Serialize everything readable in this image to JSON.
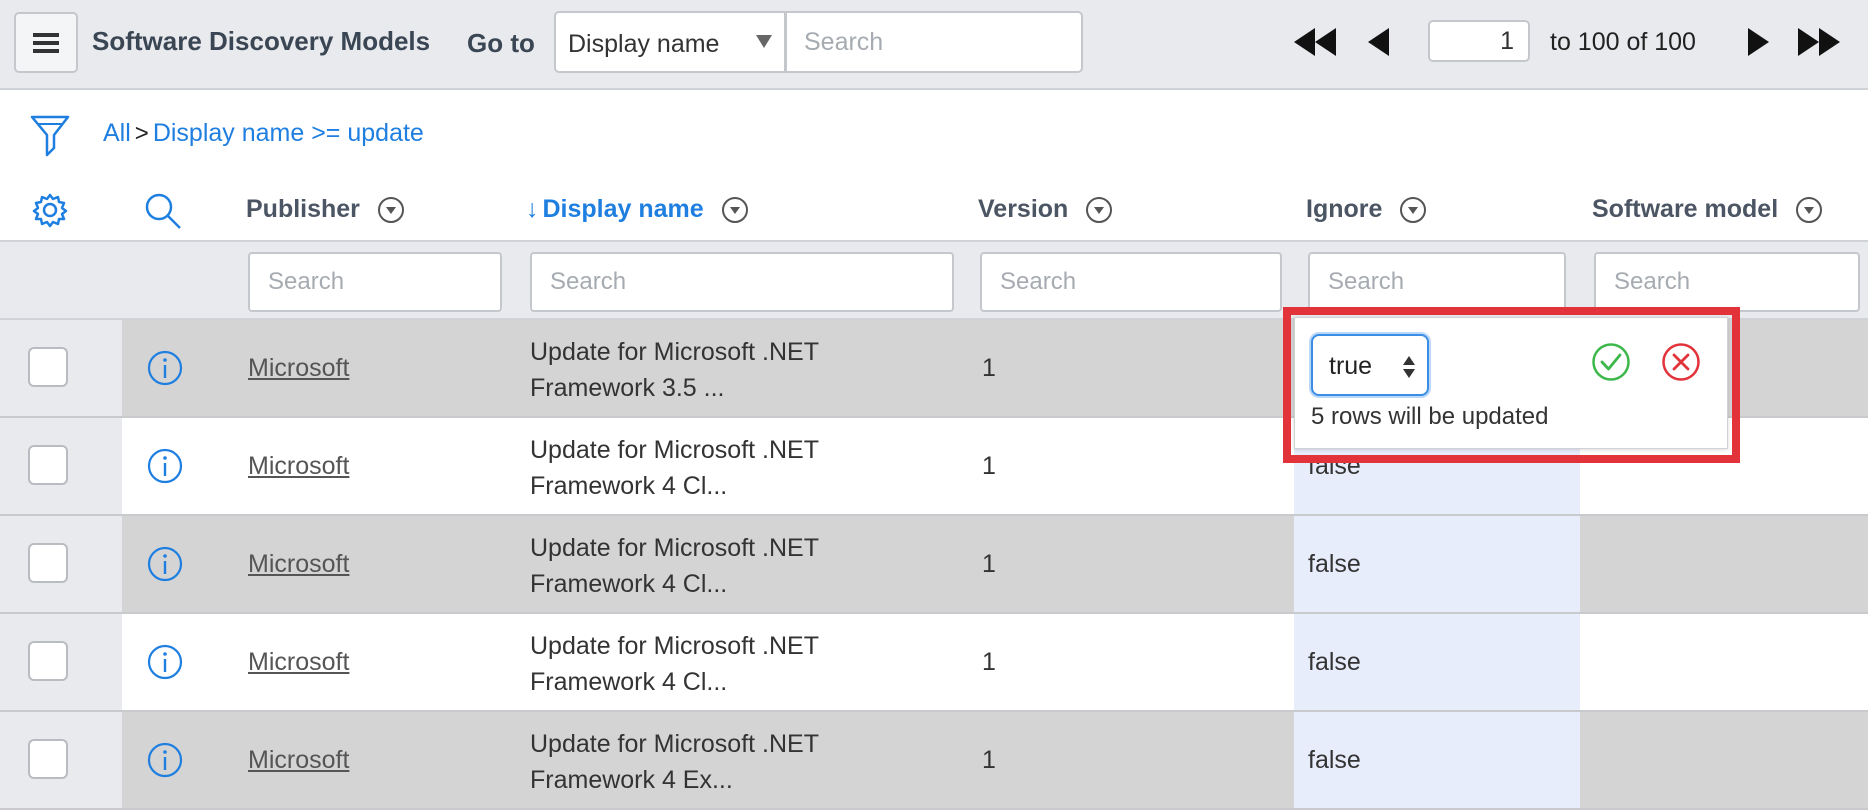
{
  "header": {
    "title": "Software Discovery Models",
    "goto_label": "Go to",
    "goto_field": "Display name",
    "search_placeholder": "Search",
    "pager": {
      "current_page": "1",
      "range_text": "to 100 of 100"
    }
  },
  "breadcrumb": {
    "root": "All",
    "separator": ">",
    "condition": "Display name >= update"
  },
  "columns": {
    "publisher": "Publisher",
    "sort_indicator": "↓",
    "display_name": "Display name",
    "version": "Version",
    "ignore": "Ignore",
    "software_model": "Software model"
  },
  "filters": {
    "placeholder": "Search"
  },
  "rows": [
    {
      "publisher": "Microsoft",
      "display_name": "Update for Microsoft .NET Framework 3.5 ...",
      "version": "1",
      "ignore": "false"
    },
    {
      "publisher": "Microsoft",
      "display_name": "Update for Microsoft .NET Framework 4 Cl...",
      "version": "1",
      "ignore": "false"
    },
    {
      "publisher": "Microsoft",
      "display_name": "Update for Microsoft .NET Framework 4 Cl...",
      "version": "1",
      "ignore": "false"
    },
    {
      "publisher": "Microsoft",
      "display_name": "Update for Microsoft .NET Framework 4 Cl...",
      "version": "1",
      "ignore": "false"
    },
    {
      "publisher": "Microsoft",
      "display_name": "Update for Microsoft .NET Framework 4 Ex...",
      "version": "1",
      "ignore": "false"
    }
  ],
  "inline_edit": {
    "selected_value": "true",
    "message": "5 rows will be updated"
  },
  "colors": {
    "accent": "#1f7fe0",
    "confirm": "#3cb84a",
    "cancel": "#e2323a",
    "highlight": "#e2323a"
  }
}
